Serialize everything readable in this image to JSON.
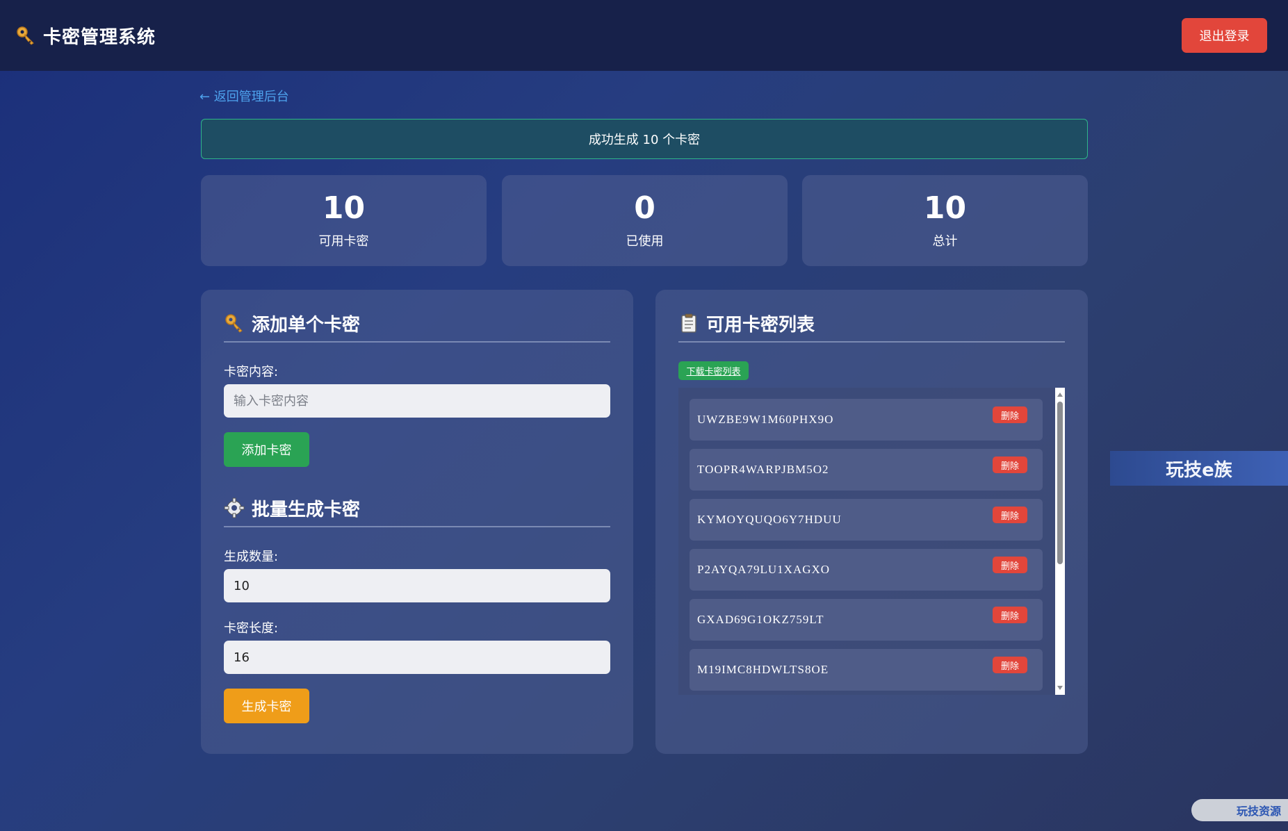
{
  "header": {
    "title": "卡密管理系统",
    "icon": "key-icon",
    "logout_label": "退出登录"
  },
  "nav": {
    "back_label": "← 返回管理后台"
  },
  "banner": {
    "message": "成功生成 10 个卡密"
  },
  "stats": [
    {
      "value": "10",
      "label": "可用卡密"
    },
    {
      "value": "0",
      "label": "已使用"
    },
    {
      "value": "10",
      "label": "总计"
    }
  ],
  "add_single": {
    "title": "添加单个卡密",
    "icon": "key-icon",
    "content_label": "卡密内容:",
    "content_placeholder": "输入卡密内容",
    "content_value": "",
    "button_label": "添加卡密"
  },
  "batch": {
    "title": "批量生成卡密",
    "icon": "gear-icon",
    "count_label": "生成数量:",
    "count_value": "10",
    "length_label": "卡密长度:",
    "length_value": "16",
    "button_label": "生成卡密"
  },
  "card_list": {
    "title": "可用卡密列表",
    "icon": "clipboard-icon",
    "download_label": "下载卡密列表",
    "delete_label": "删除",
    "items": [
      "UWZBE9W1M60PHX9O",
      "TOOPR4WARPJBM5O2",
      "KYMOYQUQO6Y7HDUU",
      "P2AYQA79LU1XAGXO",
      "GXAD69G1OKZ759LT",
      "M19IMC8HDWLTS8OE"
    ]
  },
  "watermarks": {
    "mid": "玩技e族",
    "corner": "玩技资源"
  },
  "colors": {
    "header_bg": "#17214a",
    "danger": "#e2463b",
    "success": "#2aa354",
    "warning": "#ef9d19",
    "link": "#4ea3ee"
  }
}
